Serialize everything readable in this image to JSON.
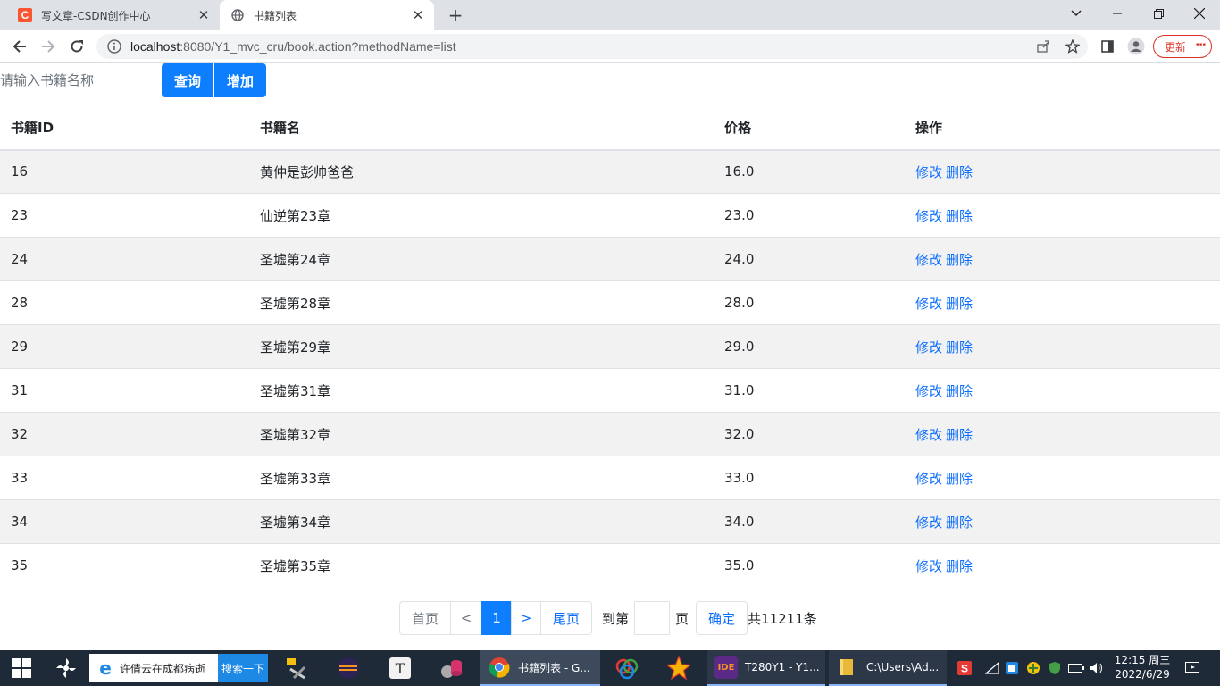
{
  "browser": {
    "tabs": [
      {
        "title": "写文章-CSDN创作中心",
        "active": false
      },
      {
        "title": "书籍列表",
        "active": true
      }
    ],
    "url_host": "localhost",
    "url_rest": ":8080/Y1_mvc_cru/book.action?methodName=list",
    "update_label": "更新"
  },
  "page": {
    "search_placeholder": "请输入书籍名称",
    "search_button": "查询",
    "add_button": "增加",
    "table": {
      "headers": [
        "书籍ID",
        "书籍名",
        "价格",
        "操作"
      ],
      "rows": [
        {
          "id": "16",
          "name": "黄仲是彭帅爸爸",
          "price": "16.0"
        },
        {
          "id": "23",
          "name": "仙逆第23章",
          "price": "23.0"
        },
        {
          "id": "24",
          "name": "圣墟第24章",
          "price": "24.0"
        },
        {
          "id": "28",
          "name": "圣墟第28章",
          "price": "28.0"
        },
        {
          "id": "29",
          "name": "圣墟第29章",
          "price": "29.0"
        },
        {
          "id": "31",
          "name": "圣墟第31章",
          "price": "31.0"
        },
        {
          "id": "32",
          "name": "圣墟第32章",
          "price": "32.0"
        },
        {
          "id": "33",
          "name": "圣墟第33章",
          "price": "33.0"
        },
        {
          "id": "34",
          "name": "圣墟第34章",
          "price": "34.0"
        },
        {
          "id": "35",
          "name": "圣墟第35章",
          "price": "35.0"
        }
      ],
      "edit_label": "修改",
      "delete_label": "删除"
    },
    "pagination": {
      "first": "首页",
      "prev": "<",
      "current": "1",
      "next": ">",
      "last": "尾页",
      "goto_prefix": "到第",
      "goto_suffix": "页",
      "confirm": "确定",
      "total": "共11211条"
    }
  },
  "taskbar": {
    "search_text": "许倩云在成都病逝",
    "search_button": "搜索一下",
    "apps": [
      {
        "label": "书籍列表 - G..."
      },
      {
        "label": "T280Y1 - Y1..."
      },
      {
        "label": "C:\\Users\\Ad..."
      }
    ],
    "time": "12:15 周三",
    "date": "2022/6/29"
  },
  "colors": {
    "primary": "#0d7efd",
    "link": "#0d6efd",
    "stripe": "#f2f2f2",
    "taskbar": "#1f2a38"
  }
}
